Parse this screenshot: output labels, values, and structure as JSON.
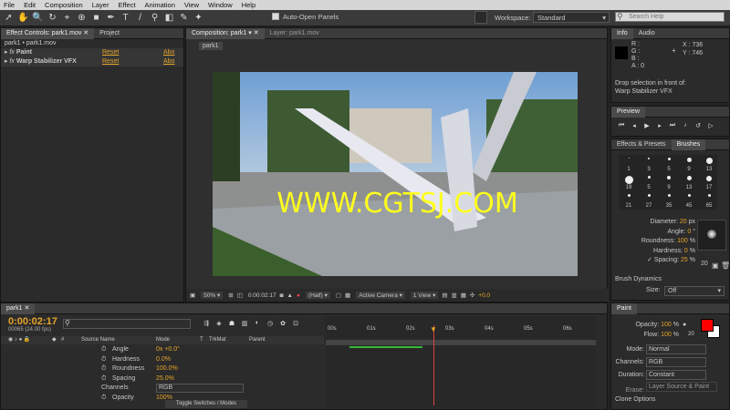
{
  "menu": [
    "File",
    "Edit",
    "Composition",
    "Layer",
    "Effect",
    "Animation",
    "View",
    "Window",
    "Help"
  ],
  "toolbar": {
    "auto_open": "Auto-Open Panels",
    "workspace_label": "Workspace:",
    "workspace_value": "Standard",
    "search_placeholder": "Search Help"
  },
  "effect_controls": {
    "tab": "Effect Controls: park1.mov",
    "project_tab": "Project",
    "breadcrumb": "park1 • park1.mov",
    "effects": [
      {
        "name": "Paint",
        "reset": "Reset",
        "about": "Abo"
      },
      {
        "name": "Warp Stabilizer VFX",
        "reset": "Reset",
        "about": "Abo"
      }
    ]
  },
  "composition": {
    "tab": "Composition: park1",
    "layer_tab": "Layer: park1.mov",
    "sub_tab": "park1",
    "watermark": "WWW.CGTSJ.COM",
    "footer": {
      "zoom": "50%",
      "timecode": "0:00:02:17",
      "resolution": "(Half)",
      "camera": "Active Camera",
      "view": "1 View",
      "offset": "+0.0"
    }
  },
  "info": {
    "tab": "Info",
    "audio_tab": "Audio",
    "r": "R :",
    "g": "G :",
    "b": "B :",
    "a": "A :  0",
    "x": "X : 736",
    "y": "Y : 746",
    "message1": "Drop selection in front of:",
    "message2": "Warp Stabilizer VFX"
  },
  "preview": {
    "tab": "Preview"
  },
  "brushes": {
    "effects_tab": "Effects & Presets",
    "brushes_tab": "Brushes",
    "sizes": [
      "1",
      "3",
      "5",
      "9",
      "13",
      "19",
      "5",
      "9",
      "13",
      "17",
      "21",
      "27",
      "35",
      "45",
      "65"
    ],
    "diameter_label": "Diameter:",
    "diameter_value": "20",
    "diameter_unit": "px",
    "angle_label": "Angle:",
    "angle_value": "0",
    "angle_unit": "°",
    "roundness_label": "Roundness:",
    "roundness_value": "100",
    "roundness_unit": "%",
    "hardness_label": "Hardness:",
    "hardness_value": "0",
    "hardness_unit": "%",
    "spacing_label": "Spacing:",
    "spacing_value": "25",
    "spacing_unit": "%",
    "dynamics": "Brush Dynamics",
    "size_label": "Size:",
    "size_value": "Off",
    "preview_num": "20"
  },
  "timeline": {
    "tab": "park1",
    "timecode": "0:00:02:17",
    "fps": "00065 (24.00 fps)",
    "col_source": "Source Name",
    "col_mode": "Mode",
    "col_t": "T",
    "col_trkmat": "TrkMat",
    "col_parent": "Parent",
    "props": [
      {
        "name": "Angle",
        "value": "0x +0.0°"
      },
      {
        "name": "Hardness",
        "value": "0.0%"
      },
      {
        "name": "Roundness",
        "value": "100.0%"
      },
      {
        "name": "Spacing",
        "value": "25.0%"
      },
      {
        "name": "Channels",
        "value": "RGB"
      },
      {
        "name": "Opacity",
        "value": "100%"
      }
    ],
    "ruler": [
      "00s",
      "01s",
      "02s",
      "03s",
      "04s",
      "05s",
      "06s"
    ],
    "toggle": "Toggle Switches / Modes"
  },
  "paint": {
    "tab": "Paint",
    "opacity_label": "Opacity:",
    "opacity_value": "100",
    "flow_label": "Flow:",
    "flow_value": "100",
    "unit": "%",
    "mode_label": "Mode:",
    "mode_value": "Normal",
    "channels_label": "Channels:",
    "channels_value": "RGB",
    "duration_label": "Duration:",
    "duration_value": "Constant",
    "erase_label": "Erase:",
    "erase_value": "Layer Source & Paint",
    "clone": "Clone Options",
    "swatch_num": "20",
    "fg_color": "#ff0000",
    "bg_color": "#ffffff"
  }
}
